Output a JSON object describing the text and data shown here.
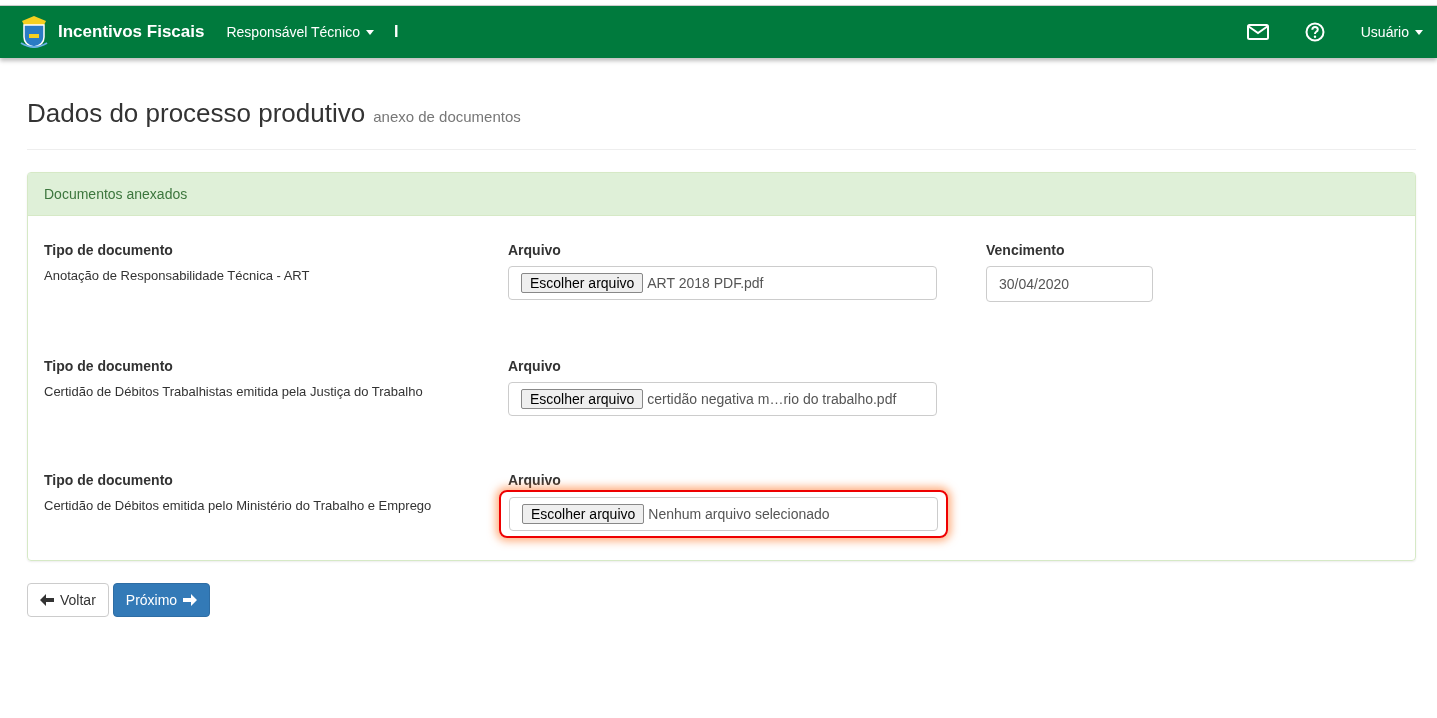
{
  "navbar": {
    "brand": "Incentivos Fiscais",
    "menu": "Responsável Técnico",
    "separator": "I",
    "user": "Usuário"
  },
  "header": {
    "title": "Dados do processo produtivo",
    "subtitle": "anexo de documentos"
  },
  "panel": {
    "heading": "Documentos anexados",
    "documents": [
      {
        "type_label": "Tipo de documento",
        "type": "Anotação de Responsabilidade Técnica - ART",
        "file_label": "Arquivo",
        "button": "Escolher arquivo",
        "file": "ART 2018 PDF.pdf",
        "highlighted": false,
        "due_label": "Vencimento",
        "due": "30/04/2020"
      },
      {
        "type_label": "Tipo de documento",
        "type": "Certidão de Débitos Trabalhistas emitida pela Justiça do Trabalho",
        "file_label": "Arquivo",
        "button": "Escolher arquivo",
        "file": "certidão negativa m…rio do trabalho.pdf",
        "highlighted": false
      },
      {
        "type_label": "Tipo de documento",
        "type": "Certidão de Débitos emitida pelo Ministério do Trabalho e Emprego",
        "file_label": "Arquivo",
        "button": "Escolher arquivo",
        "file": "Nenhum arquivo selecionado",
        "highlighted": true
      }
    ]
  },
  "buttons": [
    {
      "label": "Voltar",
      "kind": "back"
    },
    {
      "label": "Próximo",
      "kind": "next"
    }
  ]
}
